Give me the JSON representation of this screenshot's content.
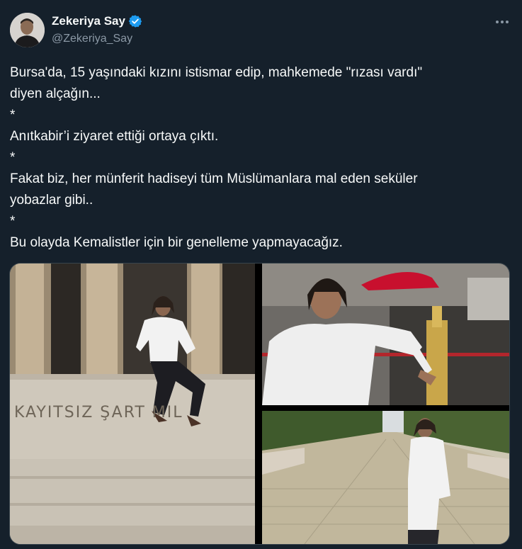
{
  "tweet": {
    "author": {
      "display_name": "Zekeriya Say",
      "handle": "@Zekeriya_Say",
      "verified": true
    },
    "more_icon": "more-horizontal-icon",
    "lines": [
      "Bursa'da, 15 yaşındaki kızını istismar edip, mahkemede \"rızası vardı\"\ndiyen alçağın...",
      "*",
      "Anıtkabir’i ziyaret ettiği ortaya çıktı.",
      "*",
      "Fakat biz, her münferit hadiseyi tüm Müslümanlara mal eden seküler\nyobazlar gibi..",
      "*",
      "Bu olayda Kemalistler için bir genelleme yapmayacağız."
    ],
    "media": {
      "count": 3,
      "inscription_text": "KAYITSIZ ŞART    MIL"
    }
  },
  "colors": {
    "background": "#15202b",
    "text_primary": "#f7f9f9",
    "text_secondary": "#8b98a5",
    "verified_badge": "#1d9bf0"
  }
}
